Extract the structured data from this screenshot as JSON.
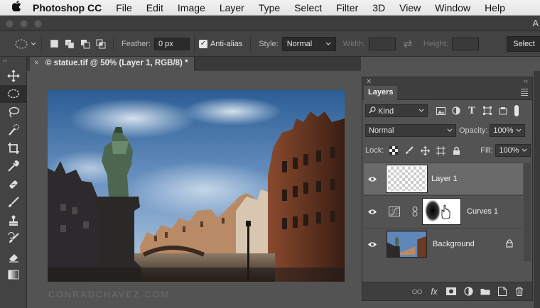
{
  "menubar": {
    "apple_icon": "apple-icon",
    "app_name": "Photoshop CC",
    "items": [
      "File",
      "Edit",
      "Image",
      "Layer",
      "Type",
      "Select",
      "Filter",
      "3D",
      "View",
      "Window",
      "Help"
    ]
  },
  "titlebar": {
    "right_glyph": "A"
  },
  "options_bar": {
    "tool_icon": "elliptical-marquee-icon",
    "feather_label": "Feather:",
    "feather_value": "0 px",
    "antialias_label": "Anti-alias",
    "antialias_checked": true,
    "style_label": "Style:",
    "style_value": "Normal",
    "width_label": "Width:",
    "height_label": "Height:",
    "select_button": "Select"
  },
  "document": {
    "tab_title": "© statue.tif @ 50% (Layer 1, RGB/8) *",
    "close_glyph": "×",
    "watermark": "CONRADCHAVEZ.COM"
  },
  "toolbar": {
    "tools": [
      "move-tool",
      "elliptical-marquee-tool",
      "lasso-tool",
      "quick-selection-tool",
      "crop-tool",
      "eyedropper-tool",
      "healing-brush-tool",
      "brush-tool",
      "clone-stamp-tool",
      "history-brush-tool",
      "eraser-tool",
      "gradient-tool"
    ],
    "active_index": 1
  },
  "layers_panel": {
    "tab_label": "Layers",
    "filter_kind": "Kind",
    "blend_mode": "Normal",
    "opacity_label": "Opacity:",
    "opacity_value": "100%",
    "lock_label": "Lock:",
    "fill_label": "Fill:",
    "fill_value": "100%",
    "layers": [
      {
        "name": "Layer 1",
        "selected": true,
        "visible": true
      },
      {
        "name": "Curves 1",
        "selected": false,
        "visible": true,
        "adjustment": true
      },
      {
        "name": "Background",
        "selected": false,
        "visible": true,
        "locked": true
      }
    ],
    "footer_fx": "fx"
  },
  "colors": {
    "app_bg": "#535353",
    "panel_dark": "#3e3e3e",
    "selected_layer": "#6a6a6a"
  }
}
